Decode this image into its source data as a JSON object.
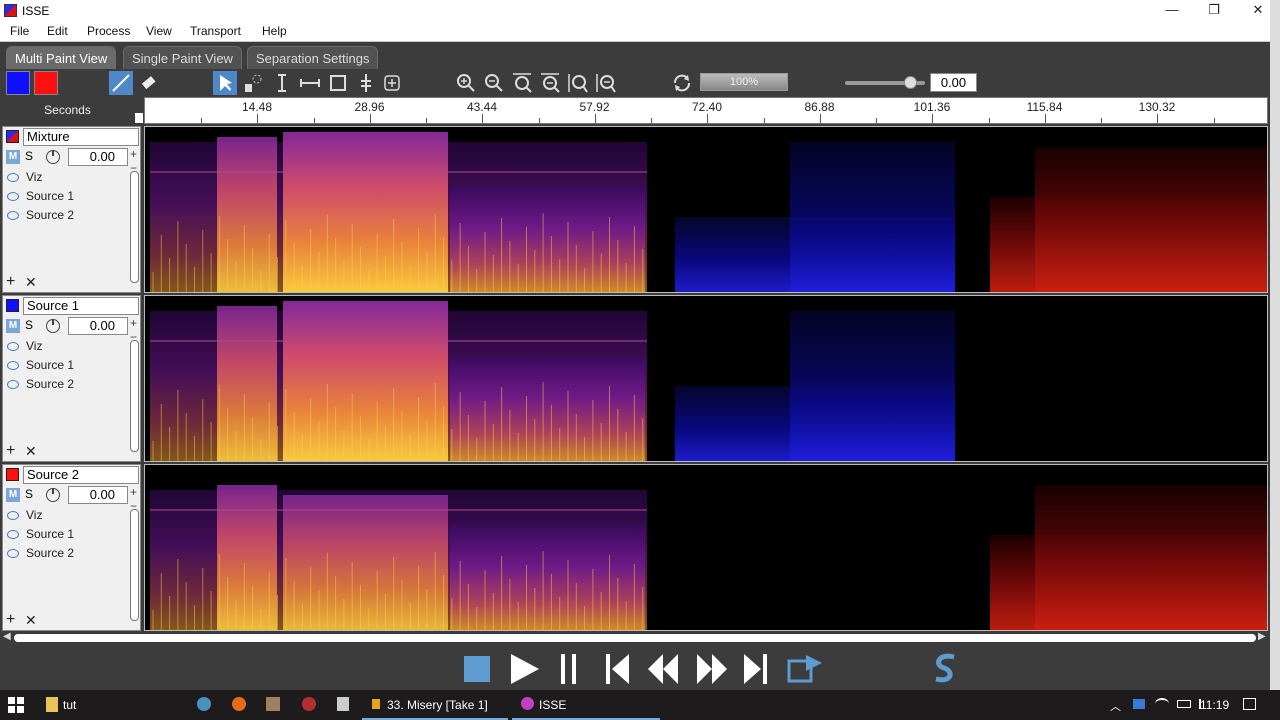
{
  "window": {
    "title": "ISSE",
    "minimize": "—",
    "restore": "❐",
    "close": "✕"
  },
  "menu": [
    "File",
    "Edit",
    "Process",
    "View",
    "Transport",
    "Help"
  ],
  "tabs": [
    {
      "label": "Multi Paint View",
      "active": true
    },
    {
      "label": "Single Paint View",
      "active": false
    },
    {
      "label": "Separation Settings",
      "active": false
    }
  ],
  "toolbar": {
    "colors": [
      "#1010ff",
      "#ff1010"
    ],
    "zoom_level": "100%",
    "gain_value": "0.00"
  },
  "ruler": {
    "label": "Seconds",
    "ticks": [
      "14.48",
      "28.96",
      "43.44",
      "57.92",
      "72.40",
      "86.88",
      "101.36",
      "115.84",
      "130.32"
    ]
  },
  "tracks": [
    {
      "name": "Mixture",
      "color_hex": "#2a2af0",
      "mute": "M",
      "solo": "S",
      "volume": "0.00",
      "layers": [
        "Viz",
        "Source 1",
        "Source 2"
      ],
      "content": "Mixture"
    },
    {
      "name": "Source 1",
      "color_hex": "#1010ff",
      "mute": "M",
      "solo": "S",
      "volume": "0.00",
      "layers": [
        "Viz",
        "Source 1",
        "Source 2"
      ],
      "content": "Source 1"
    },
    {
      "name": "Source 2",
      "color_hex": "#ff1010",
      "mute": "M",
      "solo": "S",
      "volume": "0.00",
      "layers": [
        "Viz",
        "Source 1",
        "Source 2"
      ],
      "content": "Source 2"
    }
  ],
  "taskbar": {
    "items": [
      "tut",
      "33. Misery [Take 1]",
      "ISSE"
    ],
    "clock": "11:19"
  }
}
